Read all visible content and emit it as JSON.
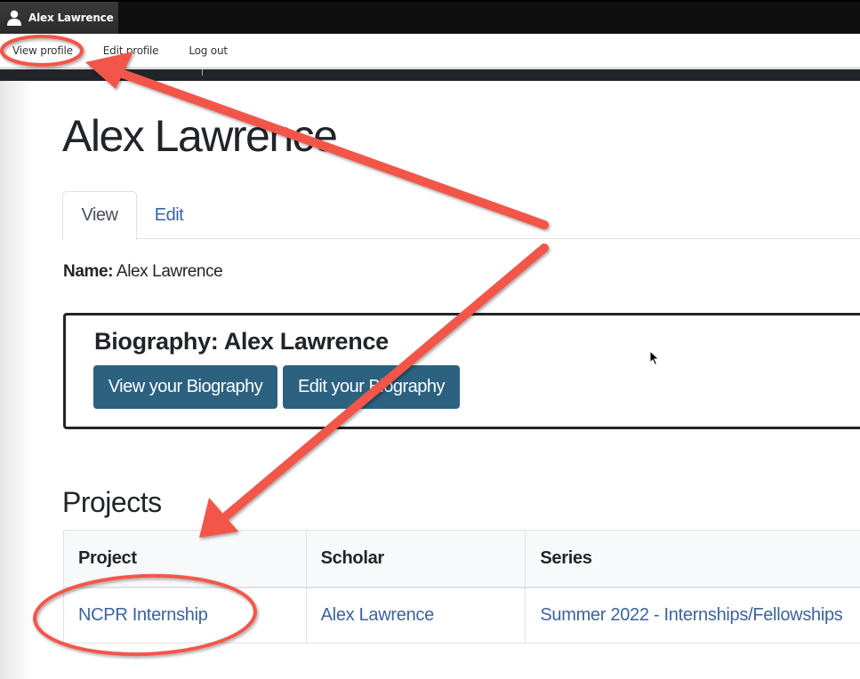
{
  "toolbar": {
    "user_name": "Alex Lawrence",
    "user_icon": "user-icon"
  },
  "tray": {
    "items": [
      {
        "label": "View profile"
      },
      {
        "label": "Edit profile"
      },
      {
        "label": "Log out"
      }
    ]
  },
  "page": {
    "title": "Alex Lawrence",
    "tabs": [
      {
        "label": "View",
        "active": true
      },
      {
        "label": "Edit",
        "active": false
      }
    ],
    "name_label": "Name:",
    "name_value": "Alex Lawrence"
  },
  "biography": {
    "title": "Biography: Alex Lawrence",
    "view_button": "View your Biography",
    "edit_button": "Edit your Biography",
    "button_color": "#2c6180"
  },
  "projects": {
    "heading": "Projects",
    "columns": [
      "Project",
      "Scholar",
      "Series"
    ],
    "rows": [
      {
        "project": "NCPR Internship",
        "scholar": "Alex Lawrence",
        "series": "Summer 2022 - Internships/Fellowships"
      }
    ]
  },
  "colors": {
    "link": "#3a63a0",
    "annotation": "#f2564a",
    "toolbar_bg": "#0f0f0f"
  },
  "annotations": {
    "highlighted": [
      "View profile",
      "NCPR Internship"
    ],
    "style": "red circled and arrows"
  }
}
